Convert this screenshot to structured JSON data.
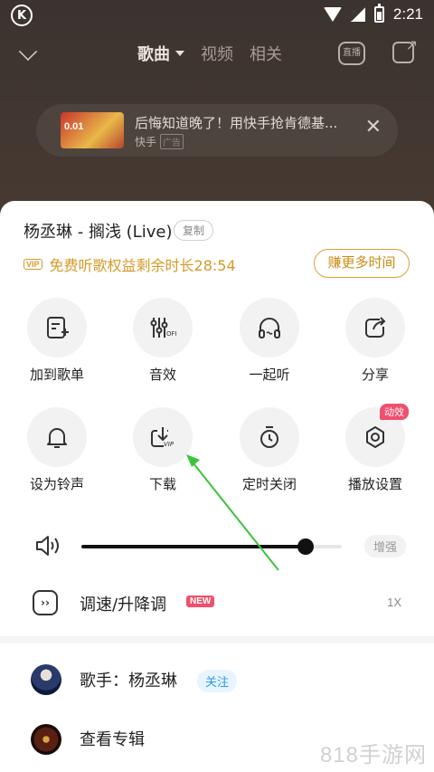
{
  "status_bar": {
    "time": "2:21",
    "app_logo": "K"
  },
  "nav": {
    "tabs": [
      {
        "label": "歌曲",
        "active": true
      },
      {
        "label": "视频",
        "active": false
      },
      {
        "label": "相关",
        "active": false
      }
    ],
    "live_label": "直播"
  },
  "ad": {
    "thumb_text": "0.01",
    "title": "后悔知道晚了！用快手抢肯德基...",
    "source": "快手",
    "tag": "广告"
  },
  "sheet": {
    "song_title": "杨丞琳 - 搁浅 (Live)",
    "copy_label": "复制",
    "vip_badge": "VIP",
    "vip_text": "免费听歌权益剩余时长28:54",
    "earn_button": "赚更多时间",
    "actions": [
      {
        "label": "加到歌单",
        "icon": "add-to-playlist-icon"
      },
      {
        "label": "音效",
        "icon": "sound-effect-icon"
      },
      {
        "label": "一起听",
        "icon": "headphones-icon"
      },
      {
        "label": "分享",
        "icon": "share-icon"
      },
      {
        "label": "设为铃声",
        "icon": "bell-icon"
      },
      {
        "label": "下载",
        "icon": "download-vip-icon"
      },
      {
        "label": "定时关闭",
        "icon": "timer-icon"
      },
      {
        "label": "播放设置",
        "icon": "settings-icon",
        "badge": "动效"
      }
    ],
    "volume": {
      "level": 0.86,
      "boost_label": "增强"
    },
    "speed": {
      "label": "调速/升降调",
      "new_badge": "NEW",
      "value": "1X"
    },
    "artist": {
      "label": "歌手：杨丞琳",
      "follow": "关注"
    },
    "album": {
      "label": "查看专辑"
    }
  },
  "watermark": "818手游网",
  "colors": {
    "vip_gold": "#d49a28",
    "badge_pink": "#f0506e",
    "follow_blue": "#2c9ae8",
    "annotation_green": "#3cc43c"
  }
}
